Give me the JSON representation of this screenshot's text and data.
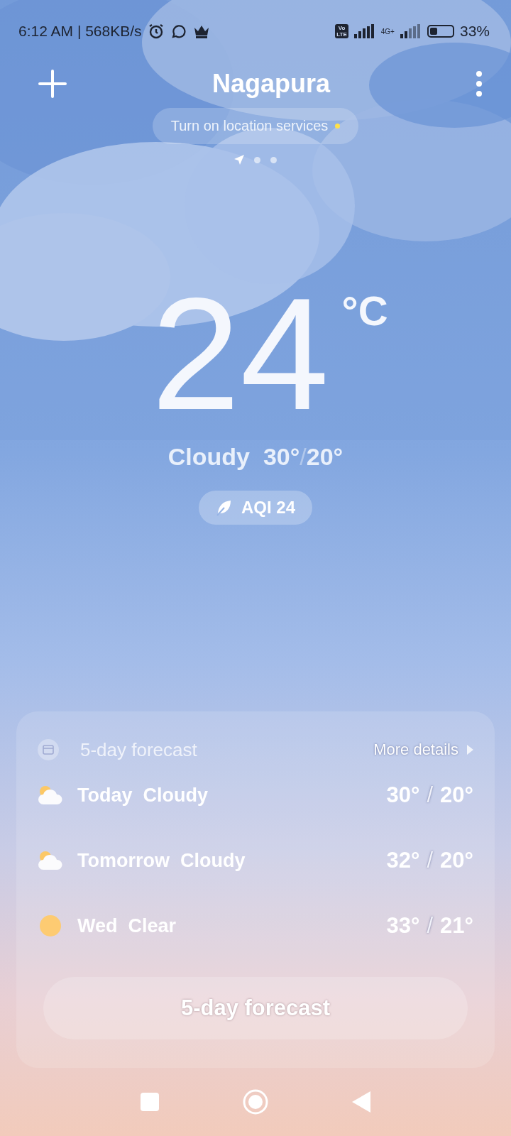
{
  "status_bar": {
    "time": "6:12 AM | 568KB/s",
    "volte": [
      "Vo",
      "LTE"
    ],
    "network_type": "4G+",
    "battery": {
      "percent": "33%"
    }
  },
  "header": {
    "city": "Nagapura",
    "location_prompt": "Turn on location services",
    "notice_dot": true,
    "pages": [
      {
        "kind": "location",
        "selected": true
      },
      {
        "kind": "dot",
        "selected": false
      },
      {
        "kind": "dot",
        "selected": false
      }
    ]
  },
  "current": {
    "temperature": "24",
    "unit": "°C",
    "condition": "Cloudy",
    "high": "30°",
    "separator": "/",
    "low": "20°",
    "aqi": "AQI 24"
  },
  "forecast": {
    "title": "5-day forecast",
    "more": "More details",
    "button": "5-day forecast",
    "days": [
      {
        "day": "Today",
        "condition": "Cloudy",
        "kind": "cloudy",
        "high": "30°",
        "separator": "/",
        "low": "20°"
      },
      {
        "day": "Tomorrow",
        "condition": "Cloudy",
        "kind": "cloudy",
        "high": "32°",
        "separator": "/",
        "low": "20°"
      },
      {
        "day": "Wed",
        "condition": "Clear",
        "kind": "clear",
        "high": "33°",
        "separator": "/",
        "low": "21°"
      }
    ]
  }
}
